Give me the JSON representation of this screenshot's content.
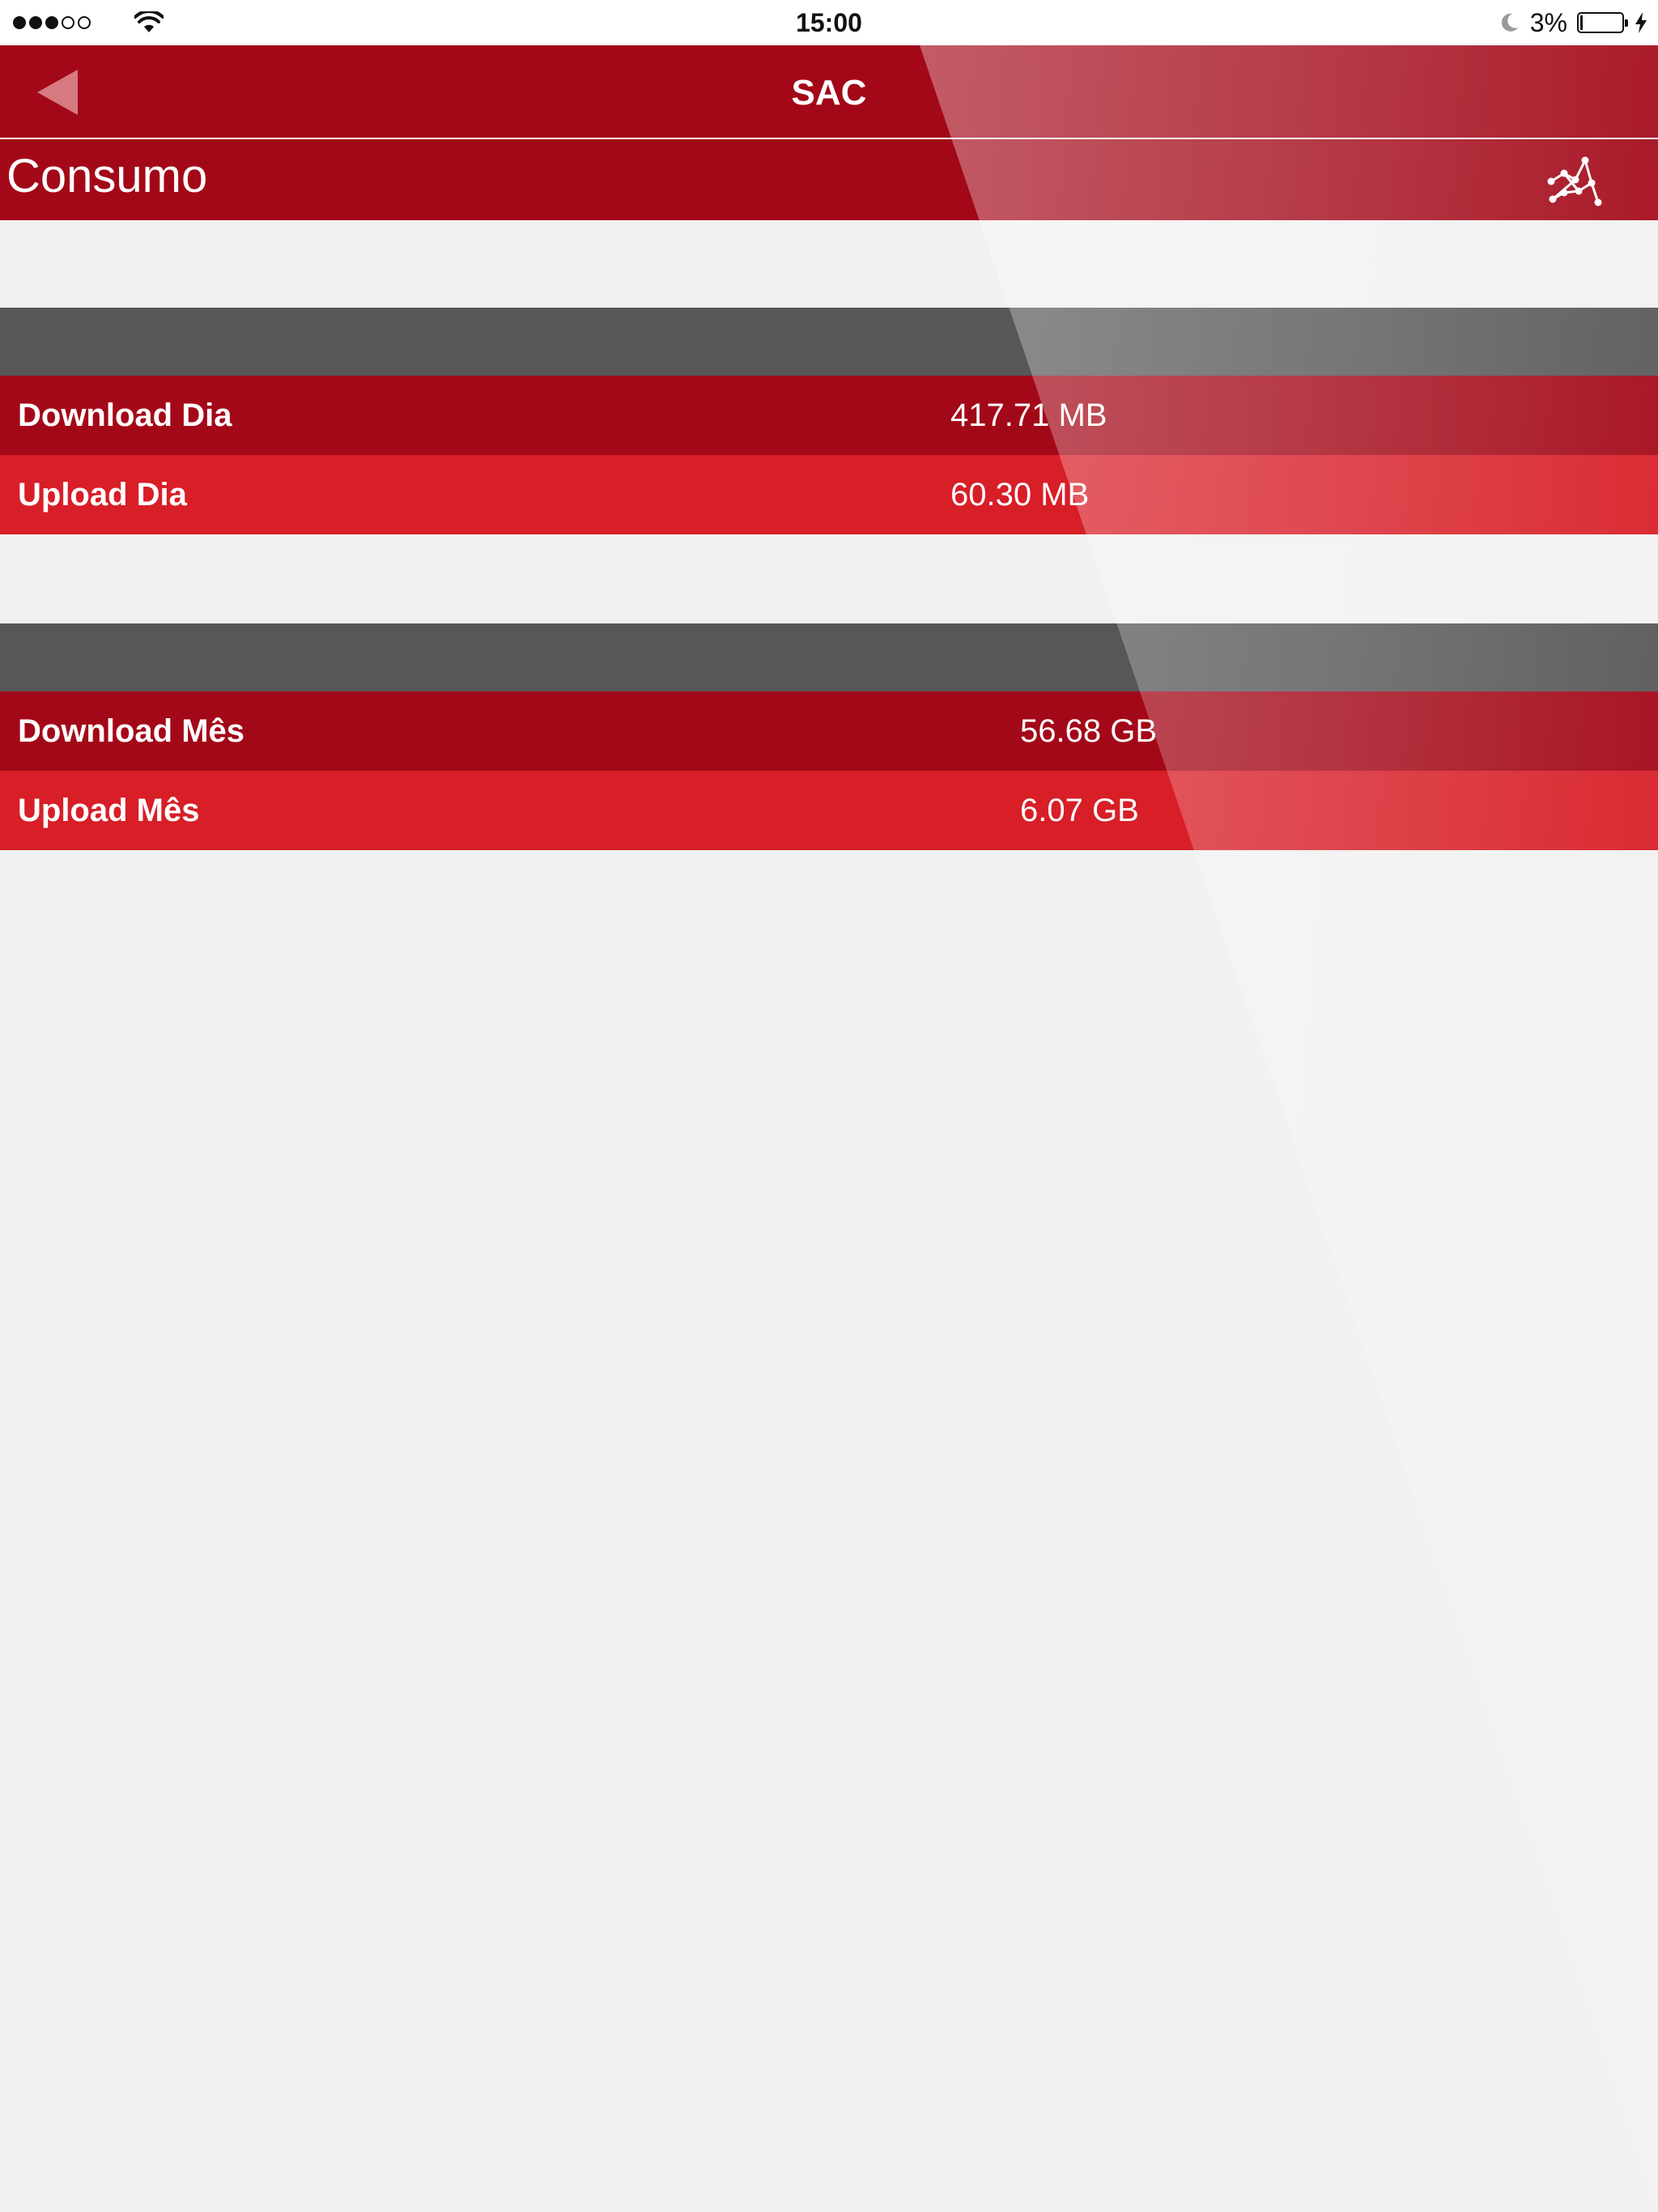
{
  "status_bar": {
    "time": "15:00",
    "battery_percent": "3%",
    "signal_bars_filled": 3,
    "signal_bars_total": 5,
    "icons": [
      "signal-dots-icon",
      "wifi-icon",
      "moon-icon",
      "battery-icon",
      "charging-bolt-icon"
    ]
  },
  "nav": {
    "title": "SAC",
    "back_icon": "back-triangle-icon"
  },
  "page": {
    "title": "Consumo",
    "action_icon": "network-graph-icon"
  },
  "sections": [
    {
      "rows": [
        {
          "label": "Download Dia",
          "value": "417.71 MB"
        },
        {
          "label": "Upload Dia",
          "value": "60.30 MB"
        }
      ]
    },
    {
      "rows": [
        {
          "label": "Download Mês",
          "value": "56.68 GB"
        },
        {
          "label": "Upload Mês",
          "value": "6.07 GB"
        }
      ]
    }
  ],
  "colors": {
    "brand_dark_red": "#a30818",
    "row_light_red": "#d81e27",
    "section_header_gray": "#575759",
    "background": "#f0f1f0",
    "status_bar_bg": "#ffffff"
  }
}
